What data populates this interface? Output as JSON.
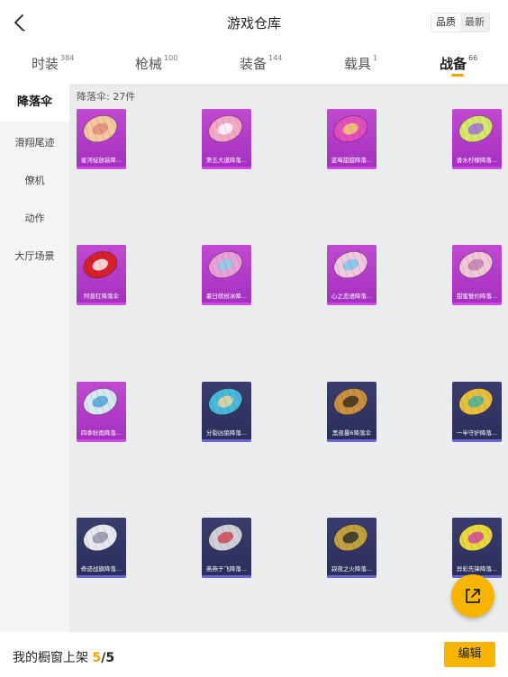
{
  "header": {
    "title": "游戏仓库",
    "sort_options": [
      "品质",
      "最新"
    ],
    "active_sort": "品质"
  },
  "tabs": [
    {
      "label": "时装",
      "count": "384"
    },
    {
      "label": "枪械",
      "count": "100"
    },
    {
      "label": "装备",
      "count": "144"
    },
    {
      "label": "载具",
      "count": "1"
    },
    {
      "label": "战备",
      "count": "66",
      "active": true
    }
  ],
  "sidebar": {
    "items": [
      "降落伞",
      "滑翔尾迹",
      "僚机",
      "动作",
      "大厅场景"
    ],
    "active": "降落伞"
  },
  "content": {
    "count_label": "降落伞: 27件",
    "items": [
      {
        "name": "星河绽放装降...",
        "tier": "purple",
        "canopy": "#f2c9a0",
        "pattern": "#e38a7a",
        "icon": "parachute-icon"
      },
      {
        "name": "第五大道降落...",
        "tier": "purple",
        "canopy": "#f4a8c8",
        "pattern": "#ffffff",
        "icon": "parachute-icon"
      },
      {
        "name": "蓝莓甜甜降落...",
        "tier": "purple",
        "canopy": "#e34fbf",
        "pattern": "#f4d36a",
        "icon": "parachute-icon"
      },
      {
        "name": "香水柠檬降落...",
        "tier": "purple",
        "canopy": "#d6e86a",
        "pattern": "#9b6be0",
        "icon": "parachute-icon"
      },
      {
        "name": "阿普红降落伞",
        "tier": "purple",
        "canopy": "#d6202a",
        "pattern": "#ffffff",
        "icon": "parachute-icon"
      },
      {
        "name": "夏日缤纷冰降...",
        "tier": "purple",
        "canopy": "#e8a0d8",
        "pattern": "#8bd0e8",
        "icon": "parachute-icon"
      },
      {
        "name": "心之恋语降落...",
        "tier": "purple",
        "canopy": "#f0c8e0",
        "pattern": "#7ac8e8",
        "icon": "parachute-icon"
      },
      {
        "name": "甜蜜誓约降落...",
        "tier": "purple",
        "canopy": "#f0c8d8",
        "pattern": "#c080b0",
        "icon": "parachute-icon"
      },
      {
        "name": "四季秋雨降落...",
        "tier": "purple",
        "canopy": "#d8e8f0",
        "pattern": "#4aa0d8",
        "icon": "parachute-icon"
      },
      {
        "name": "分裂凶狼降落...",
        "tier": "blue",
        "canopy": "#4ab8d8",
        "pattern": "#f0d8a0",
        "icon": "parachute-icon"
      },
      {
        "name": "黑夜暴6降落伞",
        "tier": "blue",
        "canopy": "#c89040",
        "pattern": "#3a2a1a",
        "icon": "parachute-icon"
      },
      {
        "name": "一半守护降落...",
        "tier": "blue",
        "canopy": "#e8c040",
        "pattern": "#40b0a0",
        "icon": "parachute-icon"
      },
      {
        "name": "奇迹战旗降落...",
        "tier": "blue",
        "canopy": "#e8e8f0",
        "pattern": "#9090a8",
        "icon": "parachute-icon"
      },
      {
        "name": "燕燕于飞降落...",
        "tier": "blue",
        "canopy": "#d0d0d8",
        "pattern": "#d04050",
        "icon": "parachute-icon"
      },
      {
        "name": "寂夜之火降落...",
        "tier": "blue",
        "canopy": "#c0a040",
        "pattern": "#2a2a2a",
        "icon": "parachute-icon"
      },
      {
        "name": "异彩先锋降落...",
        "tier": "blue",
        "canopy": "#e8d840",
        "pattern": "#d040a0",
        "icon": "parachute-icon"
      }
    ]
  },
  "bottom_bar": {
    "label": "我的橱窗上架 ",
    "current": "5",
    "separator": "/",
    "total": "5",
    "edit_label": "编辑"
  },
  "colors": {
    "accent": "#f7b500",
    "purple_tier": "#b03bc8",
    "blue_tier": "#33356a"
  },
  "icons": {
    "back": "chevron-left-icon",
    "fab": "share-external-icon"
  }
}
